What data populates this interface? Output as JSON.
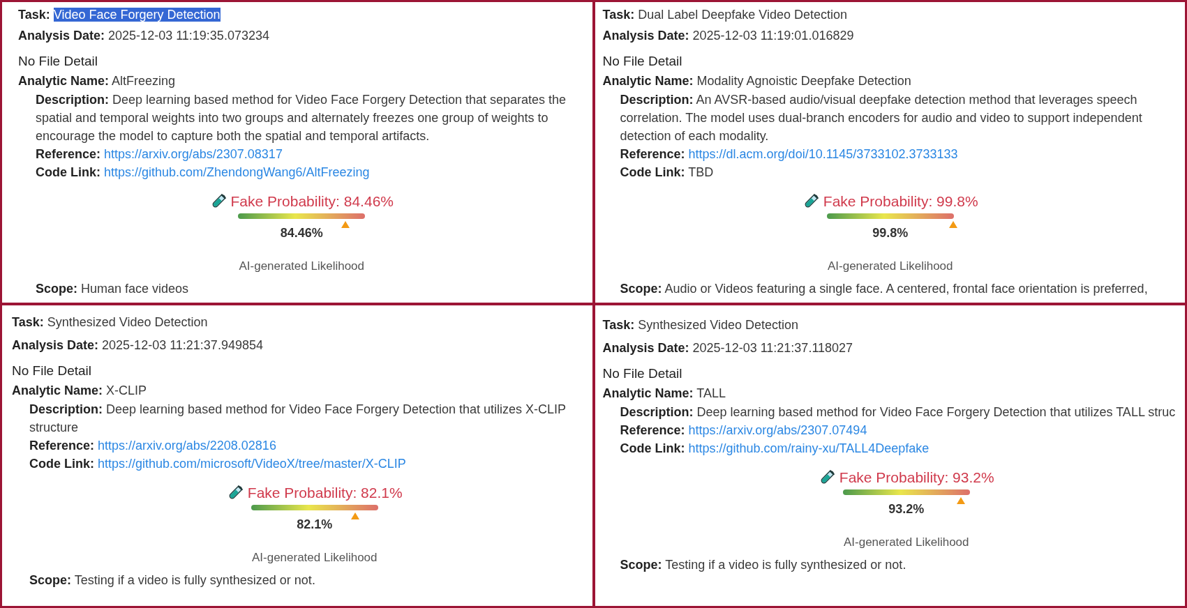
{
  "panels": [
    {
      "task": {
        "label": "Task:",
        "value": "Video Face Forgery Detection",
        "highlighted": true
      },
      "analysis_date": {
        "label": "Analysis Date:",
        "value": "2025-12-03 11:19:35.073234"
      },
      "file_detail": "No File Detail",
      "analytic_name": {
        "label": "Analytic Name:",
        "value": "AltFreezing"
      },
      "details": [
        {
          "kind": "paragraph",
          "label": "Description:",
          "value": "Deep learning based method for Video Face Forgery Detection that separates the spatial and temporal weights into two groups and alternately freezes one group of weights to encourage the model to capture both the spatial and temporal artifacts."
        },
        {
          "kind": "link",
          "label": "Reference:",
          "value": "https://arxiv.org/abs/2307.08317"
        },
        {
          "kind": "link",
          "label": "Code Link:",
          "value": "https://github.com/ZhendongWang6/AltFreezing"
        }
      ],
      "fake_probability": {
        "label": "Fake Probability: 84.46%",
        "level": 0.8446,
        "reading": "84.46%"
      },
      "likelihood_label": "AI-generated Likelihood",
      "scope": {
        "label": "Scope:",
        "value": "Human face videos"
      }
    },
    {
      "task": {
        "label": "Task:",
        "value": "Dual Label Deepfake Video Detection",
        "highlighted": false
      },
      "analysis_date": {
        "label": "Analysis Date:",
        "value": "2025-12-03 11:19:01.016829"
      },
      "file_detail": "No File Detail",
      "analytic_name": {
        "label": "Analytic Name:",
        "value": "Modality Agnoistic Deepfake Detection"
      },
      "details": [
        {
          "kind": "paragraph",
          "label": "Description:",
          "value": "An AVSR-based audio/visual deepfake detection method that leverages speech correlation. The model uses dual-branch encoders for audio and video to support independent detection of each modality."
        },
        {
          "kind": "link",
          "label": "Reference:",
          "value": "https://dl.acm.org/doi/10.1145/3733102.3733133"
        },
        {
          "kind": "text",
          "label": "Code Link:",
          "value": "TBD"
        }
      ],
      "fake_probability": {
        "label": "Fake Probability: 99.8%",
        "level": 0.998,
        "reading": "99.8%"
      },
      "likelihood_label": "AI-generated Likelihood",
      "scope": {
        "label": "Scope:",
        "value": "Audio or Videos featuring a single face. A centered, frontal face orientation is preferred,"
      }
    },
    {
      "task": {
        "label": "Task:",
        "value": "Synthesized Video Detection",
        "highlighted": false
      },
      "analysis_date": {
        "label": "Analysis Date:",
        "value": "2025-12-03 11:21:37.949854"
      },
      "file_detail": "No File Detail",
      "analytic_name": {
        "label": "Analytic Name:",
        "value": "X-CLIP"
      },
      "details": [
        {
          "kind": "paragraph",
          "label": "Description:",
          "value": "Deep learning based method for Video Face Forgery Detection that utilizes X-CLIP structure"
        },
        {
          "kind": "link",
          "label": "Reference:",
          "value": "https://arxiv.org/abs/2208.02816"
        },
        {
          "kind": "link",
          "label": "Code Link:",
          "value": "https://github.com/microsoft/VideoX/tree/master/X-CLIP"
        }
      ],
      "fake_probability": {
        "label": "Fake Probability: 82.1%",
        "level": 0.821,
        "reading": "82.1%"
      },
      "likelihood_label": "AI-generated Likelihood",
      "scope": {
        "label": "Scope:",
        "value": "Testing if a video is fully synthesized or not."
      }
    },
    {
      "task": {
        "label": "Task:",
        "value": "Synthesized Video Detection",
        "highlighted": false
      },
      "analysis_date": {
        "label": "Analysis Date:",
        "value": "2025-12-03 11:21:37.118027"
      },
      "file_detail": "No File Detail",
      "analytic_name": {
        "label": "Analytic Name:",
        "value": "TALL"
      },
      "details": [
        {
          "kind": "paragraph",
          "label": "Description:",
          "value": "Deep learning based method for Video Face Forgery Detection that utilizes TALL struc"
        },
        {
          "kind": "link",
          "label": "Reference:",
          "value": "https://arxiv.org/abs/2307.07494"
        },
        {
          "kind": "link",
          "label": "Code Link:",
          "value": "https://github.com/rainy-xu/TALL4Deepfake"
        }
      ],
      "fake_probability": {
        "label": "Fake Probability: 93.2%",
        "level": 0.932,
        "reading": "93.2%"
      },
      "likelihood_label": "AI-generated Likelihood",
      "scope": {
        "label": "Scope:",
        "value": "Testing if a video is fully synthesized or not."
      }
    }
  ]
}
